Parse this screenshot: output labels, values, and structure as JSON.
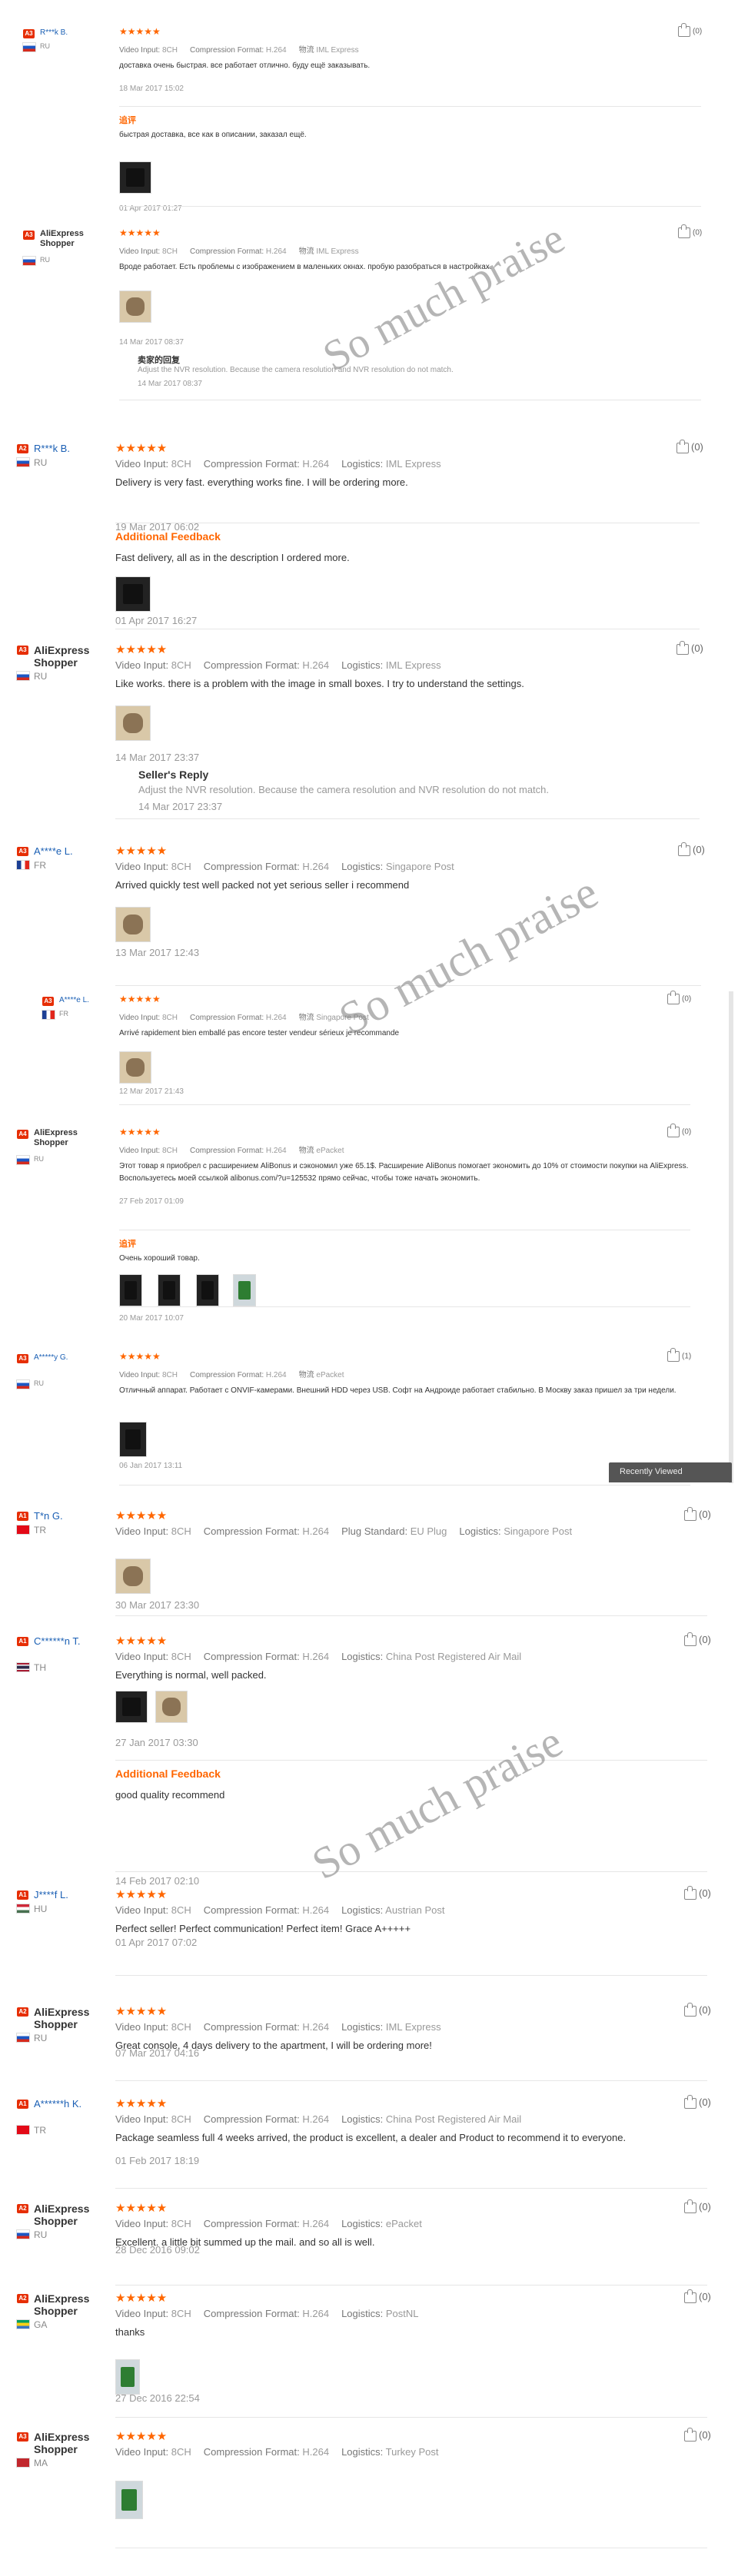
{
  "meta_labels": {
    "video_input": "Video Input:",
    "compression": "Compression Format:",
    "logistics_cn": "物流",
    "logistics": "Logistics:",
    "plug": "Plug Standard:"
  },
  "helpful_icon": "thumbs-up-icon",
  "watermark_text": "So much praise",
  "recently_viewed": "Recently Viewed",
  "reviews": [
    {
      "badge": "A3",
      "user": "R***k B.",
      "country": "RU",
      "stars": "★★★★★",
      "video": "8CH",
      "compression": "H.264",
      "logistics": "IML Express",
      "helpful": "(0)",
      "text": "доставка очень быстрая. все работает отлично. буду ещё заказывать.",
      "date": "18 Mar 2017 15:02",
      "add_label": "追评",
      "add_text": "быстрая доставка, все как в описании, заказал ещё.",
      "add_date": "01 Apr 2017 01:27"
    },
    {
      "badge": "A3",
      "user": "AliExpress Shopper",
      "country": "RU",
      "stars": "★★★★★",
      "video": "8CH",
      "compression": "H.264",
      "logistics": "IML Express",
      "helpful": "(0)",
      "text": "Вроде работает. Есть проблемы с изображением в маленьких окнах. пробую разобраться в настройках.",
      "date": "14 Mar 2017 08:37",
      "reply_title": "卖家的回复",
      "reply_text": "Adjust the NVR resolution. Because the camera resolution and NVR resolution do not match.",
      "reply_date": "14 Mar 2017 08:37"
    },
    {
      "badge": "A2",
      "user": "R***k B.",
      "country": "RU",
      "stars": "★★★★★",
      "video": "8CH",
      "compression": "H.264",
      "logistics": "IML Express",
      "helpful": "(0)",
      "text": "Delivery is very fast. everything works fine. I will be ordering more.",
      "date": "19 Mar 2017 06:02",
      "add_label": "Additional Feedback",
      "add_text": "Fast delivery, all as in the description I ordered more.",
      "add_date": "01 Apr 2017 16:27"
    },
    {
      "badge": "A3",
      "user": "AliExpress Shopper",
      "country": "RU",
      "stars": "★★★★★",
      "video": "8CH",
      "compression": "H.264",
      "logistics": "IML Express",
      "helpful": "(0)",
      "text": "Like works. there is a problem with the image in small boxes. I try to understand the settings.",
      "date": "14 Mar 2017 23:37",
      "reply_title": "Seller's Reply",
      "reply_text": "Adjust the NVR resolution. Because the camera resolution and NVR resolution do not match.",
      "reply_date": "14 Mar 2017 23:37"
    },
    {
      "badge": "A3",
      "user": "A****e L.",
      "country": "FR",
      "stars": "★★★★★",
      "video": "8CH",
      "compression": "H.264",
      "logistics": "Singapore Post",
      "helpful": "(0)",
      "text": "Arrived quickly test well packed not yet serious seller i recommend",
      "date": "13 Mar 2017 12:43"
    },
    {
      "badge": "A3",
      "user": "A****e L.",
      "country": "FR",
      "stars": "★★★★★",
      "video": "8CH",
      "compression": "H.264",
      "logistics": "Singapore Post",
      "helpful": "(0)",
      "text": "Arrivé rapidement bien emballé pas encore tester vendeur sérieux je recommande",
      "date": "12 Mar 2017 21:43"
    },
    {
      "badge": "A4",
      "user": "AliExpress Shopper",
      "country": "RU",
      "stars": "★★★★★",
      "video": "8CH",
      "compression": "H.264",
      "logistics": "ePacket",
      "helpful": "(0)",
      "text": "Этот товар я приобрел с расширением AliBonus и сэкономил уже 65.1$. Расширение AliBonus помогает экономить до 10% от стоимости покупки на AliExpress. Воспользуетесь моей ссылкой alibonus.com/?u=125532 прямо сейчас, чтобы тоже начать экономить.",
      "date": "27 Feb 2017 01:09",
      "add_label": "追评",
      "add_text": "Очень хороший товар.",
      "add_date": "20 Mar 2017 10:07"
    },
    {
      "badge": "A3",
      "user": "A*****y G.",
      "country": "RU",
      "stars": "★★★★★",
      "video": "8CH",
      "compression": "H.264",
      "logistics": "ePacket",
      "helpful": "(1)",
      "text": "Отличный аппарат. Работает с ONVIF-камерами. Внешний HDD через USB. Софт на Андроиде работает стабильно. В Москву заказ пришел за три недели.",
      "date": "06 Jan 2017 13:11"
    },
    {
      "badge": "A1",
      "user": "T*n G.",
      "country": "TR",
      "stars": "★★★★★",
      "video": "8CH",
      "compression": "H.264",
      "plug": "EU Plug",
      "logistics": "Singapore Post",
      "helpful": "(0)",
      "text": "",
      "date": "30 Mar 2017 23:30"
    },
    {
      "badge": "A1",
      "user": "C******n T.",
      "country": "TH",
      "stars": "★★★★★",
      "video": "8CH",
      "compression": "H.264",
      "logistics": "China Post Registered Air Mail",
      "helpful": "(0)",
      "text": "Everything is normal, well packed.",
      "date": "27 Jan 2017 03:30",
      "add_label": "Additional Feedback",
      "add_text": "good quality recommend",
      "add_date": "14 Feb 2017 02:10"
    },
    {
      "badge": "A1",
      "user": "J****f L.",
      "country": "HU",
      "stars": "★★★★★",
      "video": "8CH",
      "compression": "H.264",
      "logistics": "Austrian Post",
      "helpful": "(0)",
      "text": "Perfect seller! Perfect communication! Perfect item! Grace A+++++",
      "date": "01 Apr 2017 07:02"
    },
    {
      "badge": "A2",
      "user": "AliExpress Shopper",
      "country": "RU",
      "stars": "★★★★★",
      "video": "8CH",
      "compression": "H.264",
      "logistics": "IML Express",
      "helpful": "(0)",
      "text": "Great console, 4 days delivery to the apartment, I will be ordering more!",
      "date": "07 Mar 2017 04:16"
    },
    {
      "badge": "A1",
      "user": "A******h K.",
      "country": "TR",
      "stars": "★★★★★",
      "video": "8CH",
      "compression": "H.264",
      "logistics": "China Post Registered Air Mail",
      "helpful": "(0)",
      "text": "Package seamless full 4 weeks arrived, the product is excellent, a dealer and Product to recommend it to everyone.",
      "date": "01 Feb 2017 18:19"
    },
    {
      "badge": "A2",
      "user": "AliExpress Shopper",
      "country": "RU",
      "stars": "★★★★★",
      "video": "8CH",
      "compression": "H.264",
      "logistics": "ePacket",
      "helpful": "(0)",
      "text": "Excellent. a little bit summed up the mail. and so all is well.",
      "date": "28 Dec 2016 09:02"
    },
    {
      "badge": "A2",
      "user": "AliExpress Shopper",
      "country": "GA",
      "stars": "★★★★★",
      "video": "8CH",
      "compression": "H.264",
      "logistics": "PostNL",
      "helpful": "(0)",
      "text": "thanks",
      "date": "27 Dec 2016 22:54"
    },
    {
      "badge": "A3",
      "user": "AliExpress Shopper",
      "country": "MA",
      "stars": "★★★★★",
      "video": "8CH",
      "compression": "H.264",
      "logistics": "Turkey Post",
      "helpful": "(0)",
      "text": "",
      "date": ""
    }
  ]
}
